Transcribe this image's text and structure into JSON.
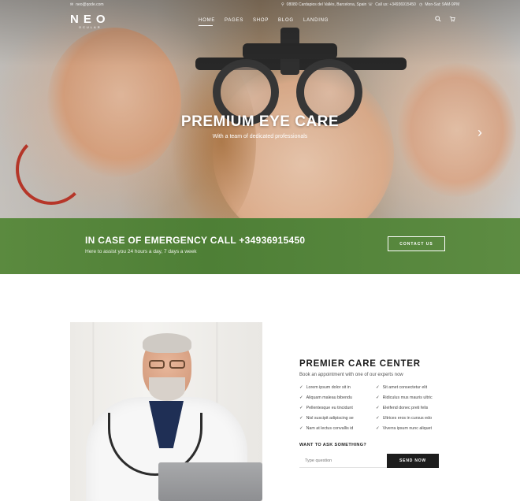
{
  "topbar": {
    "email": "neo@qode.com",
    "address": "08080 Cardapios del Vallès, Barcelona, Spain",
    "phone": "Call us: +34936915450",
    "hours": "Mon-Sat: 9AM-9PM"
  },
  "logo": {
    "main": "NEO",
    "sub": "OCULAR"
  },
  "nav": {
    "items": [
      "HOME",
      "PAGES",
      "SHOP",
      "BLOG",
      "LANDING"
    ],
    "active": "HOME"
  },
  "hero": {
    "title": "PREMIUM EYE CARE",
    "subtitle": "With a team of dedicated professionals"
  },
  "emergency": {
    "title": "IN CASE OF EMERGENCY CALL +34936915450",
    "subtitle": "Here to assist you 24 hours a day, 7 days a week",
    "button": "CONTACT US"
  },
  "care": {
    "title": "PREMIER CARE CENTER",
    "subtitle": "Book an appointment with one of our experts now",
    "features_left": [
      "Lorem ipsum dolor sit in",
      "Aliquam maleau bibendu",
      "Pellentesque eu tincidunt",
      "Nisl suscipit adipiscing se",
      "Nam at lectus convallis id"
    ],
    "features_right": [
      "Sit amet consectetur elit",
      "Ridiculus mus mauris ultric",
      "Eleifend donec preti felis",
      "Ultrices eros in cursus edo",
      "Viverra ipsum nunc aliquet"
    ],
    "ask_label": "WANT TO ASK SOMETHING?",
    "input_placeholder": "Type question",
    "send_button": "SEND NOW"
  },
  "icons": {
    "email": "envelope-icon",
    "address": "map-pin-icon",
    "phone": "phone-icon",
    "hours": "clock-icon",
    "search": "search-icon",
    "cart": "cart-icon"
  }
}
